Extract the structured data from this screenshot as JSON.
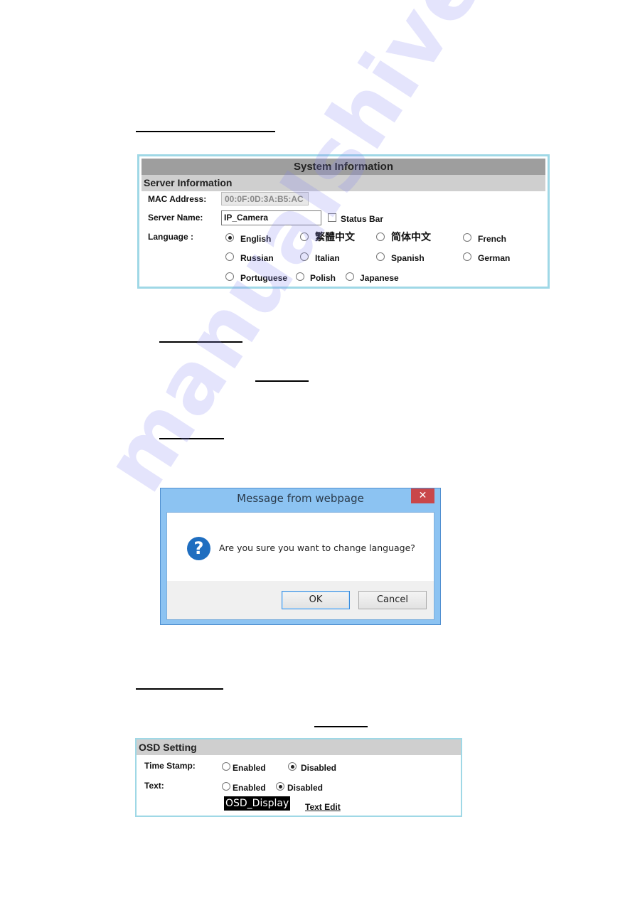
{
  "system_info_panel": {
    "title": "System Information",
    "section": "Server Information",
    "mac_label": "MAC Address:",
    "mac_value": "00:0F:0D:3A:B5:AC",
    "server_name_label": "Server Name:",
    "server_name_value": "IP_Camera",
    "status_bar_label": "Status Bar",
    "status_bar_checked": false,
    "language_label": "Language :",
    "languages": [
      {
        "label": "English",
        "checked": true
      },
      {
        "label": "繁體中文",
        "checked": false
      },
      {
        "label": "简体中文",
        "checked": false
      },
      {
        "label": "French",
        "checked": false
      },
      {
        "label": "Russian",
        "checked": false
      },
      {
        "label": "Italian",
        "checked": false
      },
      {
        "label": "Spanish",
        "checked": false
      },
      {
        "label": "German",
        "checked": false
      },
      {
        "label": "Portuguese",
        "checked": false
      },
      {
        "label": "Polish",
        "checked": false
      },
      {
        "label": "Japanese",
        "checked": false
      }
    ]
  },
  "dialog": {
    "title": "Message from webpage",
    "close_glyph": "✕",
    "icon_glyph": "?",
    "message": "Are you sure you want to change language?",
    "ok_label": "OK",
    "cancel_label": "Cancel"
  },
  "osd_panel": {
    "title": "OSD Setting",
    "time_stamp_label": "Time Stamp:",
    "text_label": "Text:",
    "enabled_label": "Enabled",
    "disabled_label": "Disabled",
    "time_stamp_value": "Disabled",
    "text_value": "Disabled",
    "osd_display_text": "OSD_Display",
    "text_edit_link": "Text Edit"
  },
  "watermark": "manualshive.com",
  "colors": {
    "panel_border": "#9fd8e6",
    "title_bar_gray": "#9e9e9e",
    "section_gray": "#cfcfcf",
    "dialog_frame": "#8cc3f2",
    "dialog_close": "#c9474a",
    "question_icon": "#1f6ec0"
  }
}
